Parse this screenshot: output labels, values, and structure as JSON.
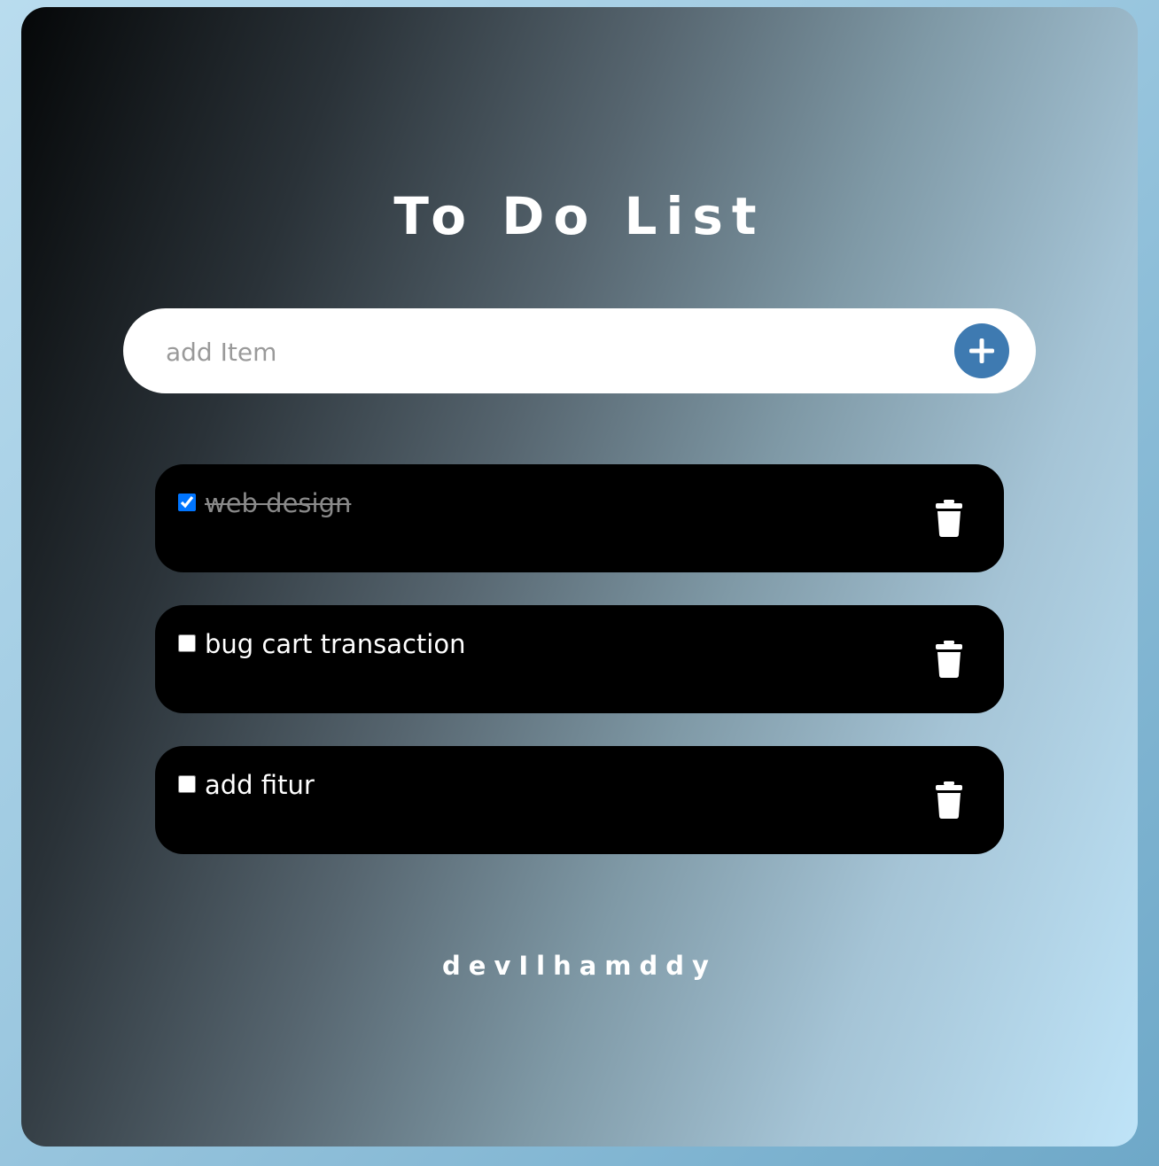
{
  "app": {
    "title": "To Do List",
    "footer": "devIlhamddy"
  },
  "input": {
    "placeholder": "add Item",
    "value": "",
    "add_icon": "plus-icon",
    "accent_color": "#3e7ab1"
  },
  "todos": [
    {
      "label": "web design",
      "done": true,
      "delete_icon": "trash-icon"
    },
    {
      "label": "bug cart transaction",
      "done": false,
      "delete_icon": "trash-icon"
    },
    {
      "label": "add fitur",
      "done": false,
      "delete_icon": "trash-icon"
    }
  ]
}
